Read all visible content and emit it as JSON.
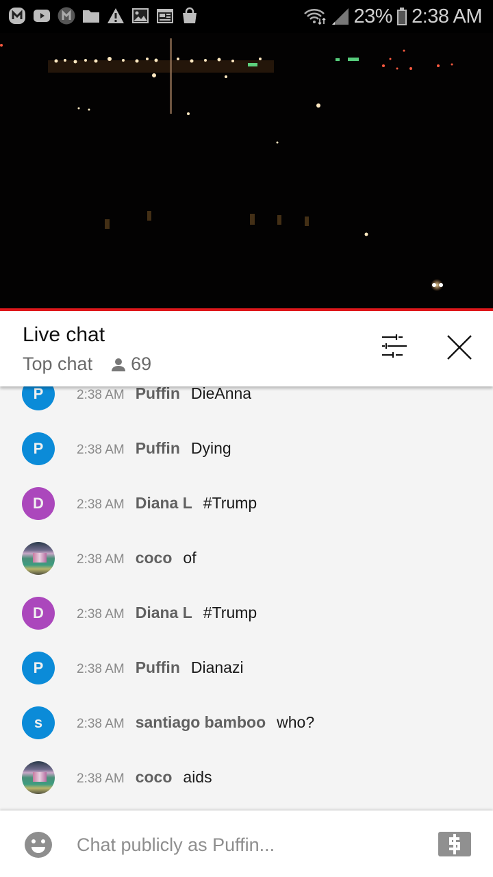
{
  "status_bar": {
    "notification_icons": [
      "messenger-icon",
      "youtube-icon",
      "messenger-alt-icon",
      "folder-icon",
      "warning-icon",
      "image-icon",
      "news-icon",
      "shopping-bag-icon"
    ],
    "battery_percent": "23%",
    "time": "2:38 AM"
  },
  "video": {
    "progress_fraction": 1.0,
    "accent_color": "#e0181c"
  },
  "chat_header": {
    "title": "Live chat",
    "mode": "Top chat",
    "viewer_count": "69"
  },
  "messages": [
    {
      "avatar_letter": "P",
      "avatar_color": "#0b8bd8",
      "time": "2:38 AM",
      "author": "Puffin",
      "text": "DieAnna"
    },
    {
      "avatar_letter": "P",
      "avatar_color": "#0b8bd8",
      "time": "2:38 AM",
      "author": "Puffin",
      "text": "Dying"
    },
    {
      "avatar_letter": "D",
      "avatar_color": "#ab47bc",
      "time": "2:38 AM",
      "author": "Diana L",
      "text": "#Trump"
    },
    {
      "avatar_letter": "",
      "avatar_color": "photo",
      "time": "2:38 AM",
      "author": "coco",
      "text": "of"
    },
    {
      "avatar_letter": "D",
      "avatar_color": "#ab47bc",
      "time": "2:38 AM",
      "author": "Diana L",
      "text": "#Trump"
    },
    {
      "avatar_letter": "P",
      "avatar_color": "#0b8bd8",
      "time": "2:38 AM",
      "author": "Puffin",
      "text": "Dianazi"
    },
    {
      "avatar_letter": "s",
      "avatar_color": "#0b8bd8",
      "time": "2:38 AM",
      "author": "santiago bamboo",
      "text": "who?"
    },
    {
      "avatar_letter": "",
      "avatar_color": "photo",
      "time": "2:38 AM",
      "author": "coco",
      "text": "aids"
    }
  ],
  "input_bar": {
    "placeholder": "Chat publicly as Puffin...",
    "value": ""
  }
}
